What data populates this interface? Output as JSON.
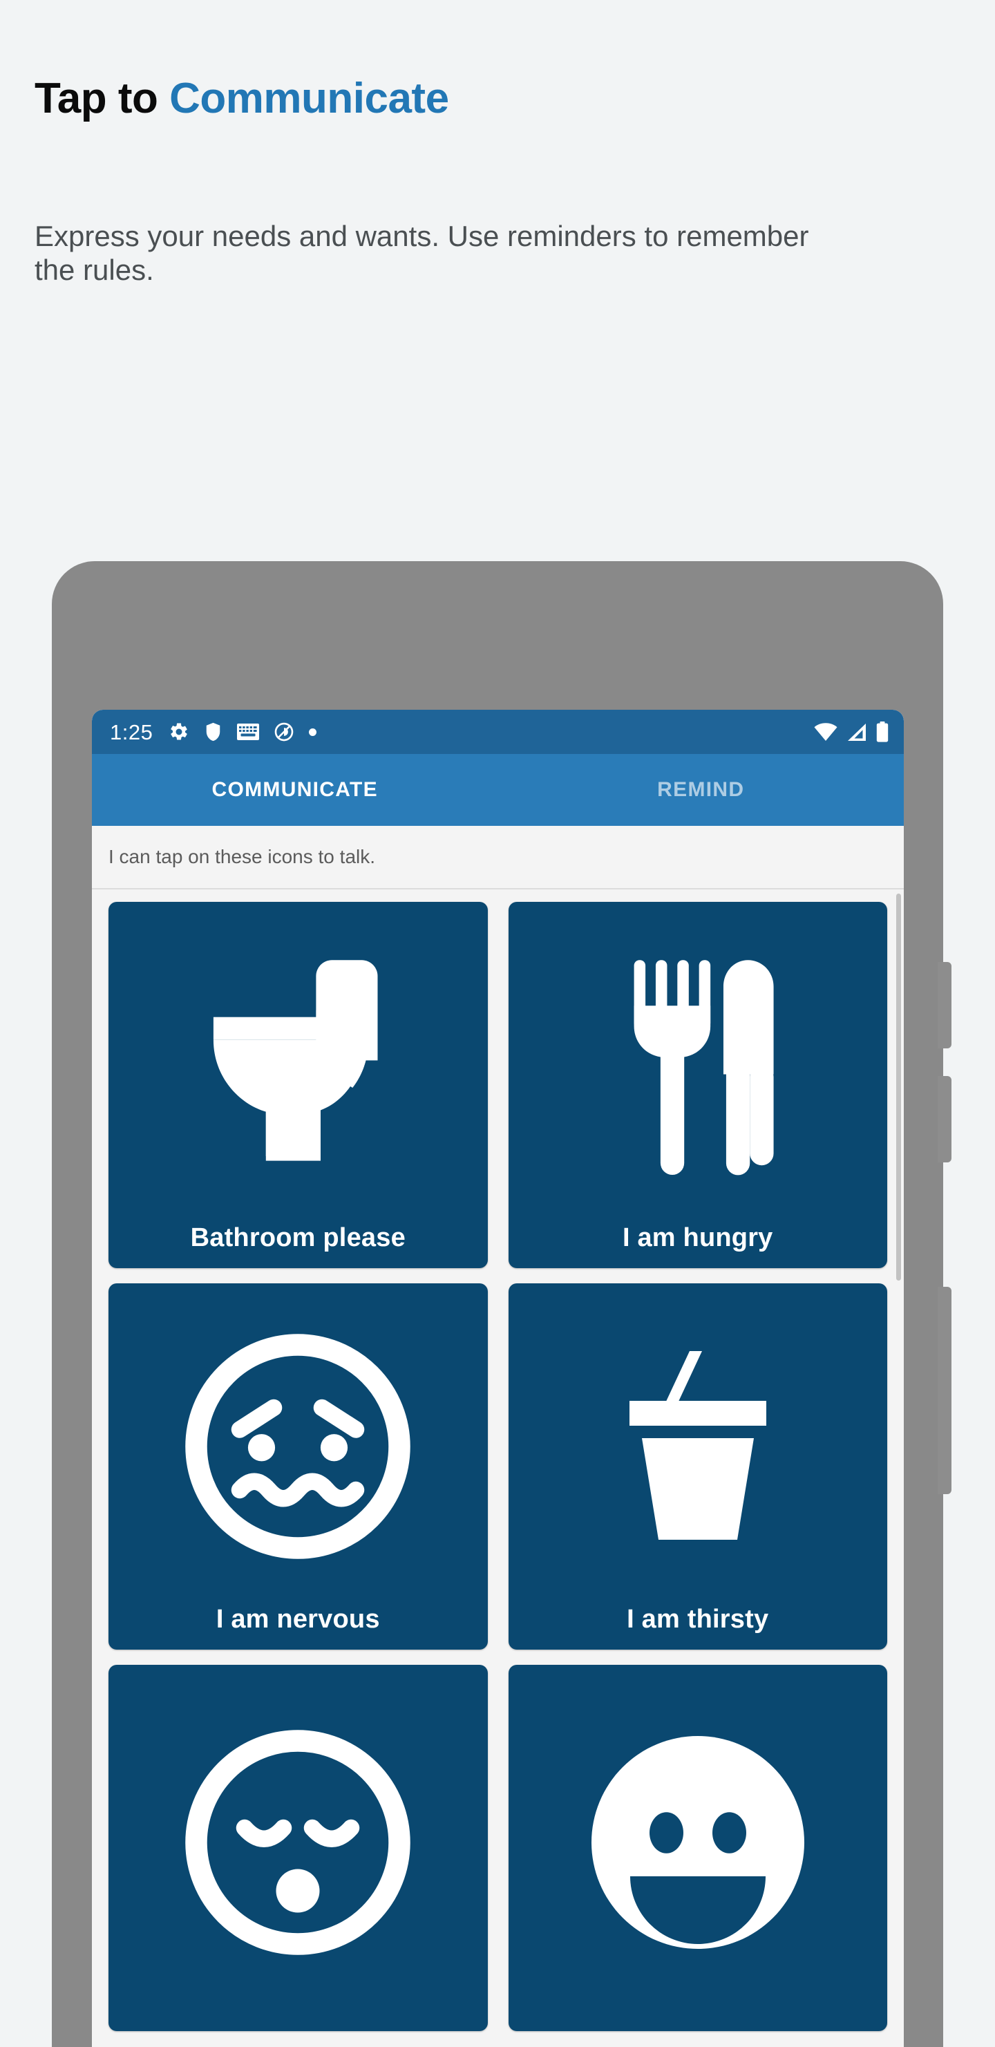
{
  "promo": {
    "title_plain": "Tap to ",
    "title_accent": "Communicate",
    "subtitle": "Express your needs and wants. Use reminders to remember the rules.",
    "accent_color": "#2277b5",
    "title_color": "#0b0b0b",
    "subtitle_color": "#4a4f52",
    "background_color": "#f2f4f5"
  },
  "phone": {
    "frame_color": "#898989",
    "screen_background": "#f2f2f2"
  },
  "statusbar": {
    "time": "1:25",
    "background_color": "#1f6498",
    "left_icons": [
      "gear-icon",
      "shield-icon",
      "keyboard-icon",
      "do-not-disturb-icon",
      "dot-icon"
    ],
    "right_icons": [
      "wifi-icon",
      "cellular-signal-icon",
      "battery-icon"
    ]
  },
  "tabs": {
    "background_color": "#2a7cb8",
    "items": [
      {
        "label": "COMMUNICATE",
        "active": true
      },
      {
        "label": "REMIND",
        "active": false
      }
    ]
  },
  "hint": {
    "text": "I can tap on these icons to talk."
  },
  "grid": {
    "card_color": "#0a4870",
    "cards": [
      {
        "label": "Bathroom please",
        "icon": "toilet-icon"
      },
      {
        "label": "I am hungry",
        "icon": "fork-knife-icon"
      },
      {
        "label": "I am nervous",
        "icon": "nervous-face-icon"
      },
      {
        "label": "I am thirsty",
        "icon": "drink-cup-icon"
      },
      {
        "label": "",
        "icon": "sleepy-face-icon"
      },
      {
        "label": "",
        "icon": "happy-face-icon"
      }
    ]
  }
}
